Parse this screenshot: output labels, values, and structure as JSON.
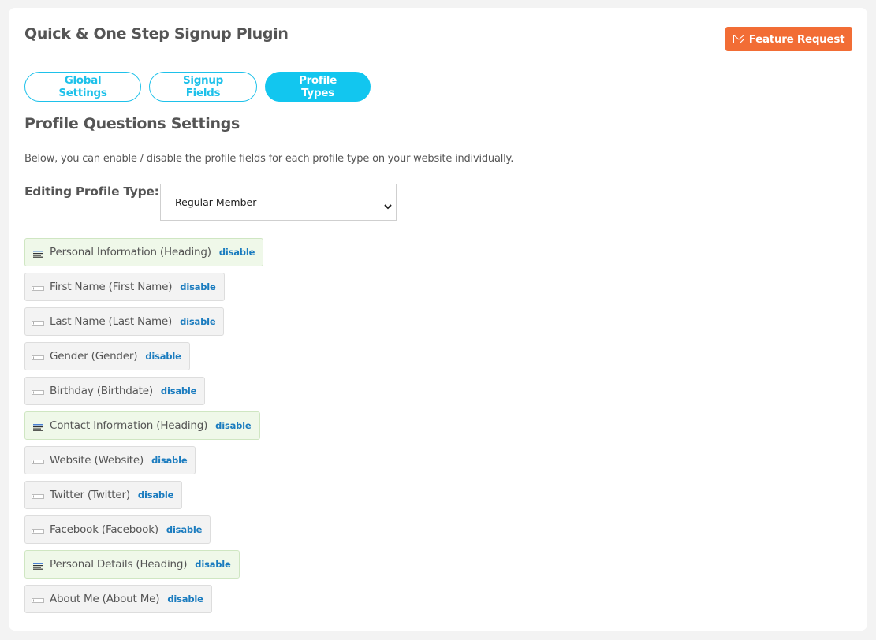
{
  "header": {
    "title": "Quick & One Step Signup Plugin",
    "feature_request_label": "Feature Request",
    "feature_request_icon": "envelope-icon",
    "feature_request_color": "#f26d35"
  },
  "tabs": [
    {
      "label": "Global Settings",
      "active": false
    },
    {
      "label": "Signup Fields",
      "active": false
    },
    {
      "label": "Profile Types",
      "active": true
    }
  ],
  "accent_color": "#12c6ef",
  "section": {
    "title": "Profile Questions Settings",
    "description": "Below, you can enable / disable the profile fields for each profile type on your website individually.",
    "profile_type_label": "Editing Profile Type:",
    "profile_type_selected": "Regular Member"
  },
  "fields": [
    {
      "label": "Personal Information (Heading)",
      "type": "heading",
      "action": "disable"
    },
    {
      "label": "First Name (First Name)",
      "type": "field",
      "action": "disable"
    },
    {
      "label": "Last Name (Last Name)",
      "type": "field",
      "action": "disable"
    },
    {
      "label": "Gender (Gender)",
      "type": "field",
      "action": "disable"
    },
    {
      "label": "Birthday (Birthdate)",
      "type": "field",
      "action": "disable"
    },
    {
      "label": "Contact Information (Heading)",
      "type": "heading",
      "action": "disable"
    },
    {
      "label": "Website (Website)",
      "type": "field",
      "action": "disable"
    },
    {
      "label": "Twitter (Twitter)",
      "type": "field",
      "action": "disable"
    },
    {
      "label": "Facebook (Facebook)",
      "type": "field",
      "action": "disable"
    },
    {
      "label": "Personal Details (Heading)",
      "type": "heading",
      "action": "disable"
    },
    {
      "label": "About Me (About Me)",
      "type": "field",
      "action": "disable"
    }
  ]
}
